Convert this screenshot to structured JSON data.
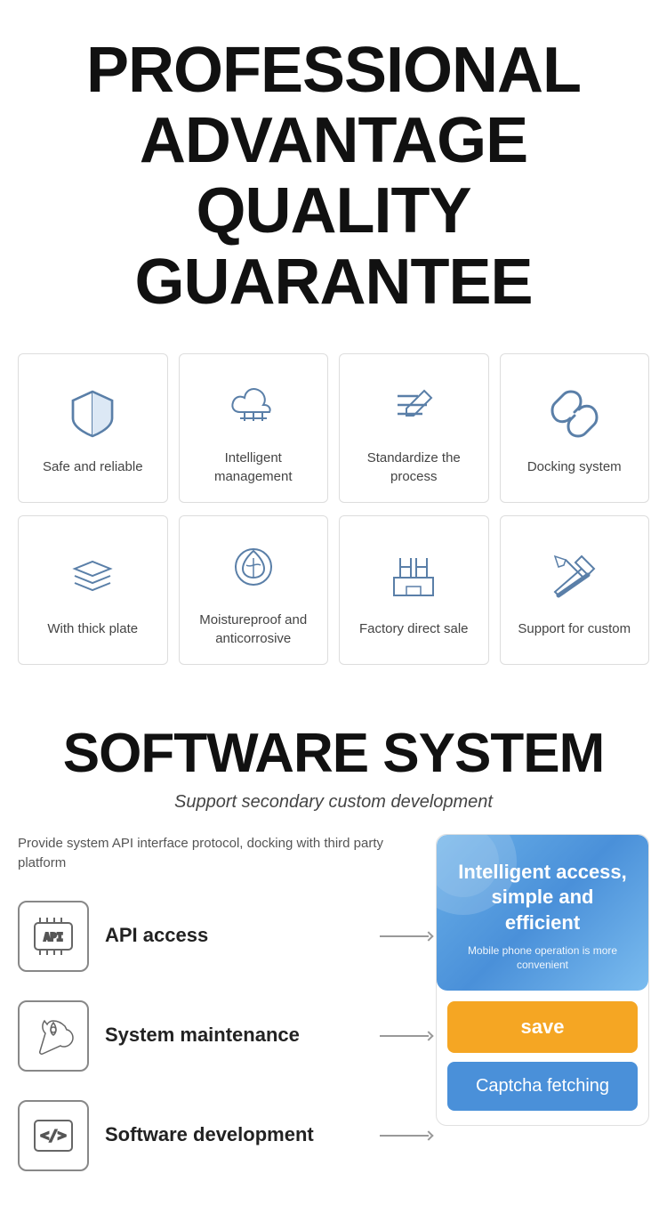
{
  "header": {
    "line1": "PROFESSIONAL",
    "line2": "ADVANTAGE",
    "line3": "QUALITY GUARANTEE"
  },
  "features_row1": [
    {
      "id": "safe-reliable",
      "label": "Safe and reliable",
      "icon": "shield"
    },
    {
      "id": "intelligent-management",
      "label": "Intelligent management",
      "icon": "cloud-settings"
    },
    {
      "id": "standardize-process",
      "label": "Standardize the process",
      "icon": "pencil-lines"
    },
    {
      "id": "docking-system",
      "label": "Docking system",
      "icon": "link"
    }
  ],
  "features_row2": [
    {
      "id": "thick-plate",
      "label": "With thick plate",
      "icon": "layers"
    },
    {
      "id": "moistureproof",
      "label": "Moistureproof and anticorrosive",
      "icon": "leaf-shield"
    },
    {
      "id": "factory-direct",
      "label": "Factory direct sale",
      "icon": "factory"
    },
    {
      "id": "support-custom",
      "label": "Support for custom",
      "icon": "tools"
    }
  ],
  "software": {
    "title": "SOFTWARE SYSTEM",
    "subtitle": "Support secondary custom development",
    "description": "Provide system API interface protocol, docking with third party platform",
    "items": [
      {
        "id": "api-access",
        "label": "API access",
        "icon": "api"
      },
      {
        "id": "system-maintenance",
        "label": "System maintenance",
        "icon": "wrench-drop"
      },
      {
        "id": "software-development",
        "label": "Software development",
        "icon": "code"
      }
    ],
    "panel": {
      "title": "Intelligent access, simple and efficient",
      "subtitle": "Mobile phone operation is more convenient",
      "save_label": "save",
      "captcha_label": "Captcha fetching"
    }
  }
}
